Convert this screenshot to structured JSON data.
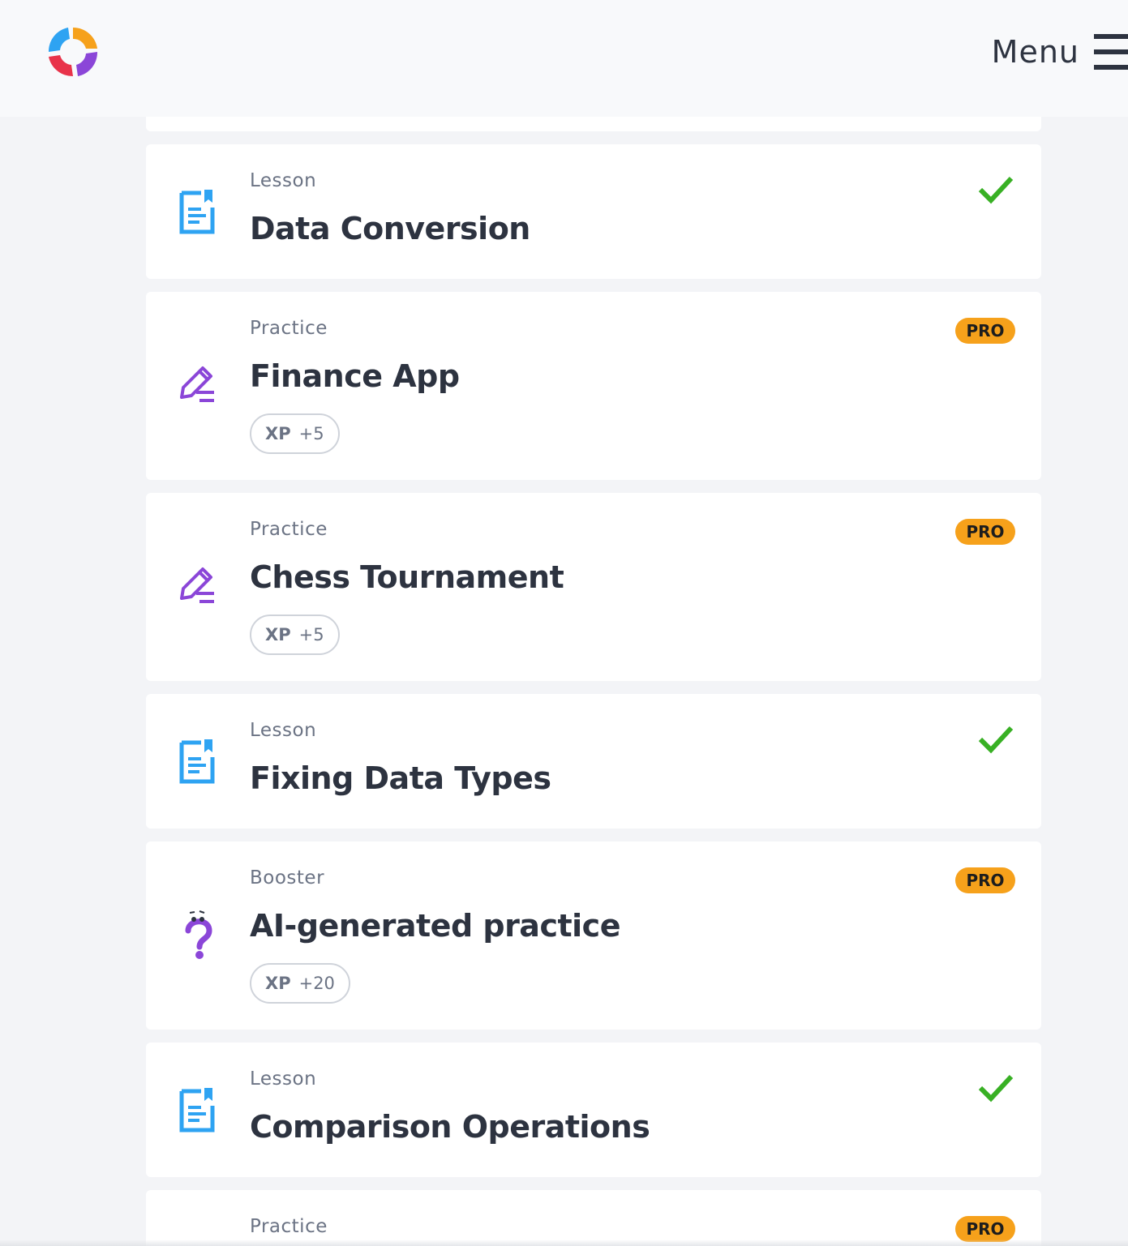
{
  "header": {
    "menu_label": "Menu",
    "brand_colors": [
      "#2ea3f2",
      "#f6a11b",
      "#e8334a",
      "#8b46d8"
    ]
  },
  "colors": {
    "lesson_icon": "#2ea3f2",
    "practice_icon": "#8b46d8",
    "check": "#38b024",
    "pro_badge": "#f6a11b"
  },
  "items": [
    {
      "kind": "Lesson",
      "title": "Data Conversion",
      "icon": "lesson-icon",
      "status": "completed"
    },
    {
      "kind": "Practice",
      "title": "Finance App",
      "icon": "practice-icon",
      "badge": "PRO",
      "xp_label": "XP",
      "xp_value": "+5"
    },
    {
      "kind": "Practice",
      "title": "Chess Tournament",
      "icon": "practice-icon",
      "badge": "PRO",
      "xp_label": "XP",
      "xp_value": "+5"
    },
    {
      "kind": "Lesson",
      "title": "Fixing Data Types",
      "icon": "lesson-icon",
      "status": "completed"
    },
    {
      "kind": "Booster",
      "title": "AI-generated practice",
      "icon": "booster-icon",
      "badge": "PRO",
      "xp_label": "XP",
      "xp_value": "+20"
    },
    {
      "kind": "Lesson",
      "title": "Comparison Operations",
      "icon": "lesson-icon",
      "status": "completed"
    },
    {
      "kind": "Practice",
      "title": "",
      "icon": "practice-icon",
      "badge": "PRO"
    }
  ]
}
